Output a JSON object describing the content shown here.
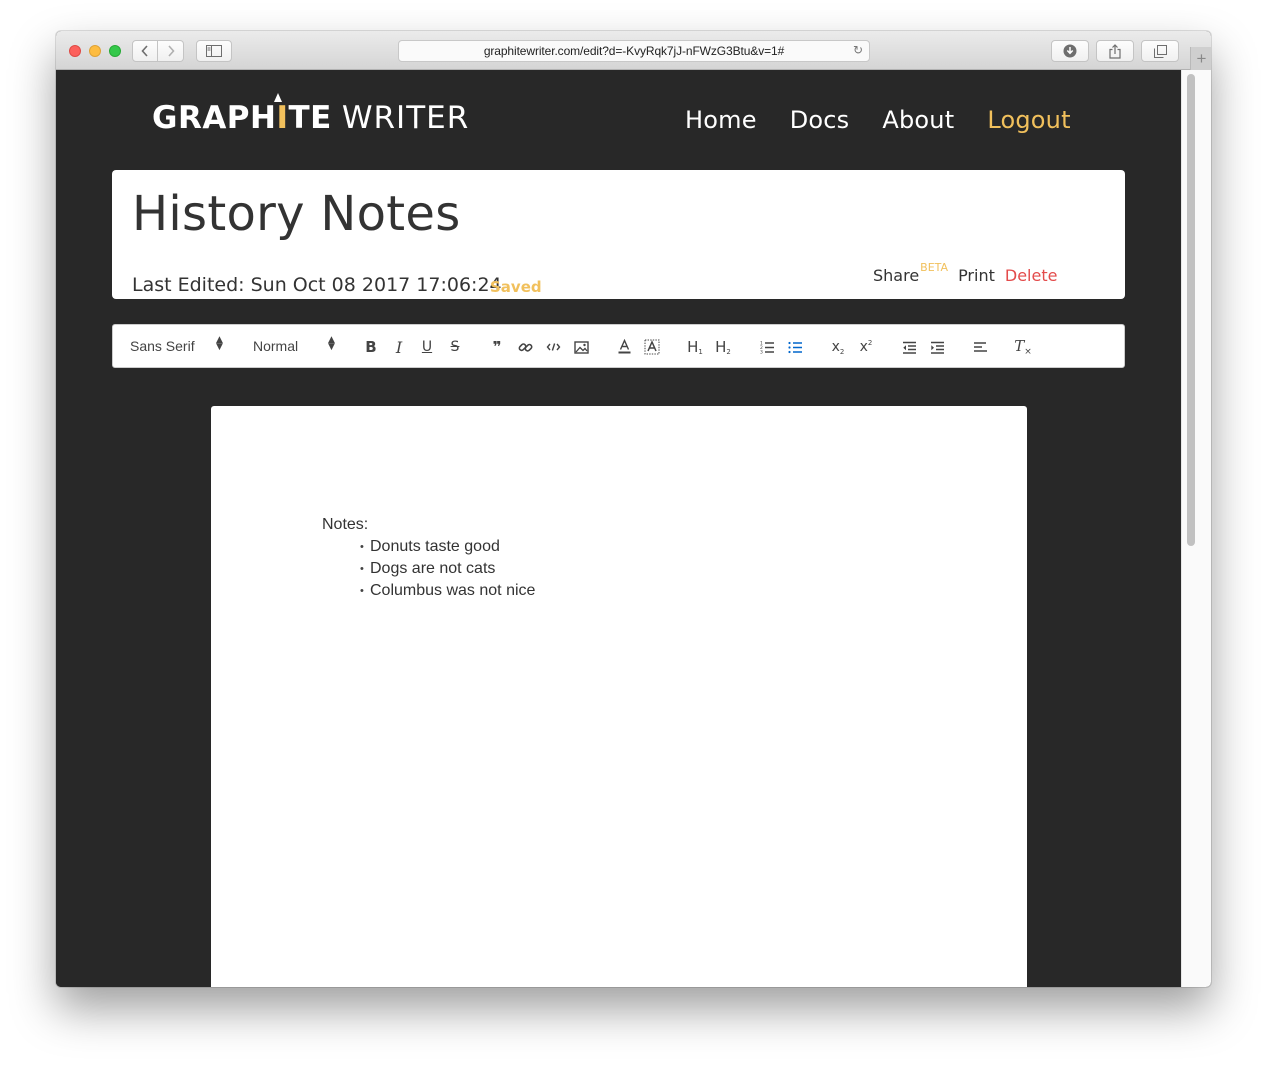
{
  "browser": {
    "url": "graphitewriter.com/edit?d=-KvyRqk7jJ-nFWzG3Btu&v=1#",
    "icons": [
      "back-icon",
      "forward-icon",
      "sidebar-icon",
      "reload-icon",
      "downloads-icon",
      "share-icon",
      "tabs-icon",
      "new-tab-icon"
    ],
    "new_tab_label": "+"
  },
  "logo": {
    "part1": "GRAPH",
    "part_gold": "I",
    "part2": "TE",
    "word2": "WRITER"
  },
  "nav": {
    "home": "Home",
    "docs": "Docs",
    "about": "About",
    "logout": "Logout"
  },
  "document": {
    "title": "History Notes",
    "last_edited": "Last Edited: Sun Oct 08 2017 17:06:24",
    "status": "Saved",
    "share": "Share",
    "share_badge": "BETA",
    "print": "Print",
    "delete": "Delete"
  },
  "toolbar": {
    "font": "Sans Serif",
    "size": "Normal",
    "select_arrows": "▲▼",
    "buttons": [
      "bold",
      "italic",
      "underline",
      "strike",
      "blockquote",
      "link",
      "code",
      "image",
      "text-color",
      "background-color",
      "header-1",
      "header-2",
      "ordered-list",
      "bullet-list",
      "subscript",
      "superscript",
      "outdent",
      "indent",
      "align",
      "clean"
    ],
    "bold": "B",
    "italic": "I",
    "underline": "U",
    "strike": "S",
    "blockquote": "❞",
    "h1": "H",
    "h2": "H",
    "sub": "x",
    "sup": "x",
    "clean": "T",
    "active_color": "#06c"
  },
  "editor": {
    "heading": "Notes:",
    "bullets": [
      "Donuts taste good",
      "Dogs are not cats",
      "Columbus was not nice"
    ]
  },
  "colors": {
    "background": "#282828",
    "accent": "#f1c05c",
    "danger": "#e34b4b"
  }
}
